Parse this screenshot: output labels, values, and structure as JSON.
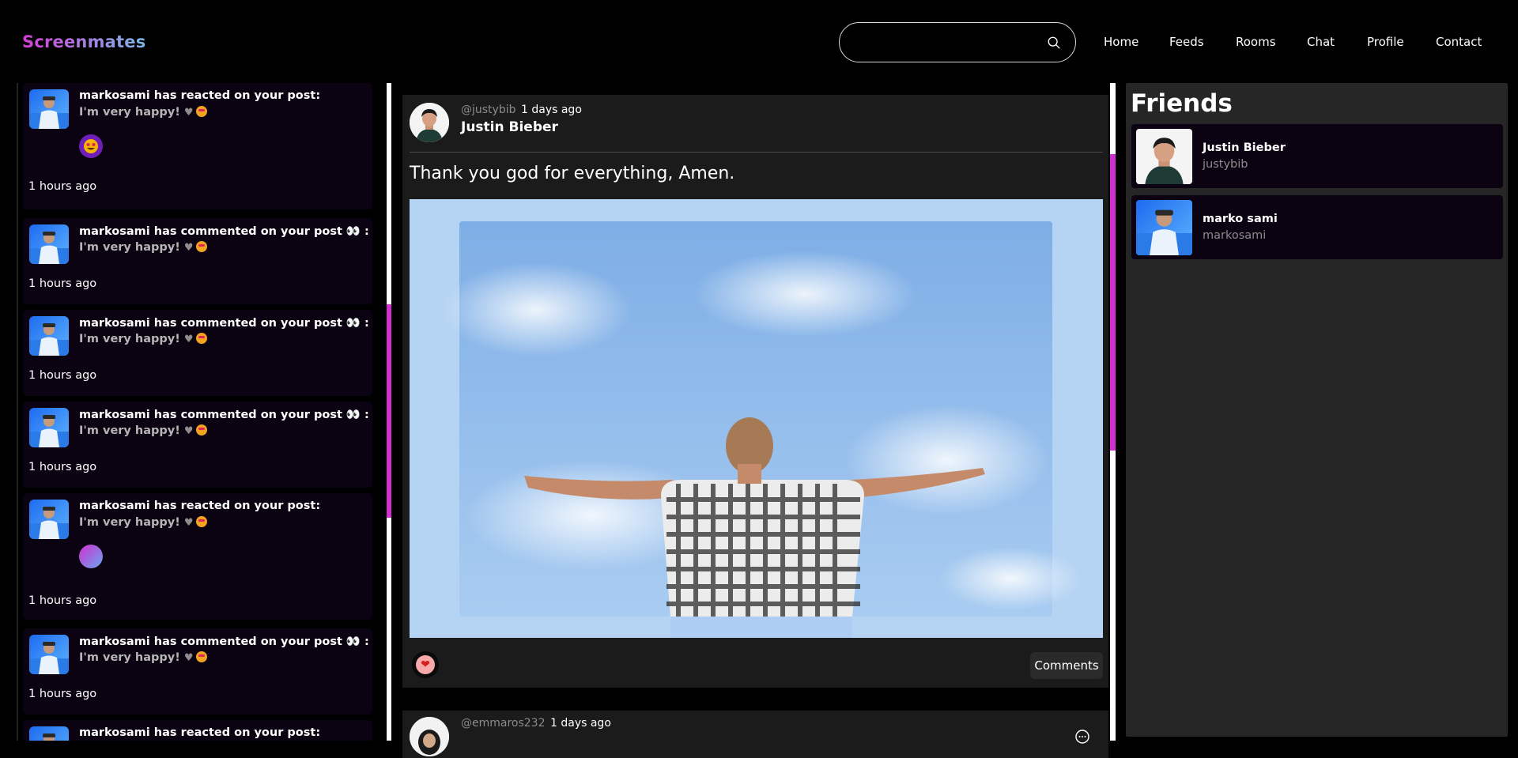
{
  "header": {
    "logo": "Screenmates",
    "search": {
      "placeholder": "",
      "value": ""
    },
    "nav": [
      "Home",
      "Feeds",
      "Rooms",
      "Chat",
      "Profile",
      "Contact"
    ]
  },
  "notifications": [
    {
      "text": "markosami has reacted on your post:",
      "message": "I'm very happy! 🩶🤩",
      "time": "1 hours ago",
      "reaction": "star-struck"
    },
    {
      "text": "markosami has commented on your post 👀 :",
      "message": "I'm very happy! 🩶🤩",
      "time": "1 hours ago"
    },
    {
      "text": "markosami has commented on your post 👀 :",
      "message": "I'm very happy! 🩶🤩",
      "time": "1 hours ago"
    },
    {
      "text": "markosami has commented on your post 👀 :",
      "message": "I'm very happy! 🩶🤩",
      "time": "1 hours ago"
    },
    {
      "text": "markosami has reacted on your post:",
      "message": "I'm very happy! 🩶🤩",
      "time": "1 hours ago",
      "reaction": "gradient"
    },
    {
      "text": "markosami has commented on your post 👀 :",
      "message": "I'm very happy! 🩶🤩",
      "time": "1 hours ago"
    },
    {
      "text": "markosami has reacted on your post:"
    }
  ],
  "feed": {
    "post": {
      "handle": "@justybib",
      "ago": "1 days ago",
      "name": "Justin Bieber",
      "caption": "Thank you god for everything, Amen.",
      "like_icon": "heart-icon",
      "comments_label": "Comments"
    },
    "next_post": {
      "handle": "@emmaros232",
      "ago": "1 days ago"
    }
  },
  "friends": {
    "title": "Friends",
    "items": [
      {
        "name": "Justin Bieber",
        "username": "justybib"
      },
      {
        "name": "marko sami",
        "username": "markosami"
      }
    ]
  },
  "colors": {
    "accent": "#d22fd0",
    "card_dark": "#0c0312",
    "panel": "#262626"
  }
}
